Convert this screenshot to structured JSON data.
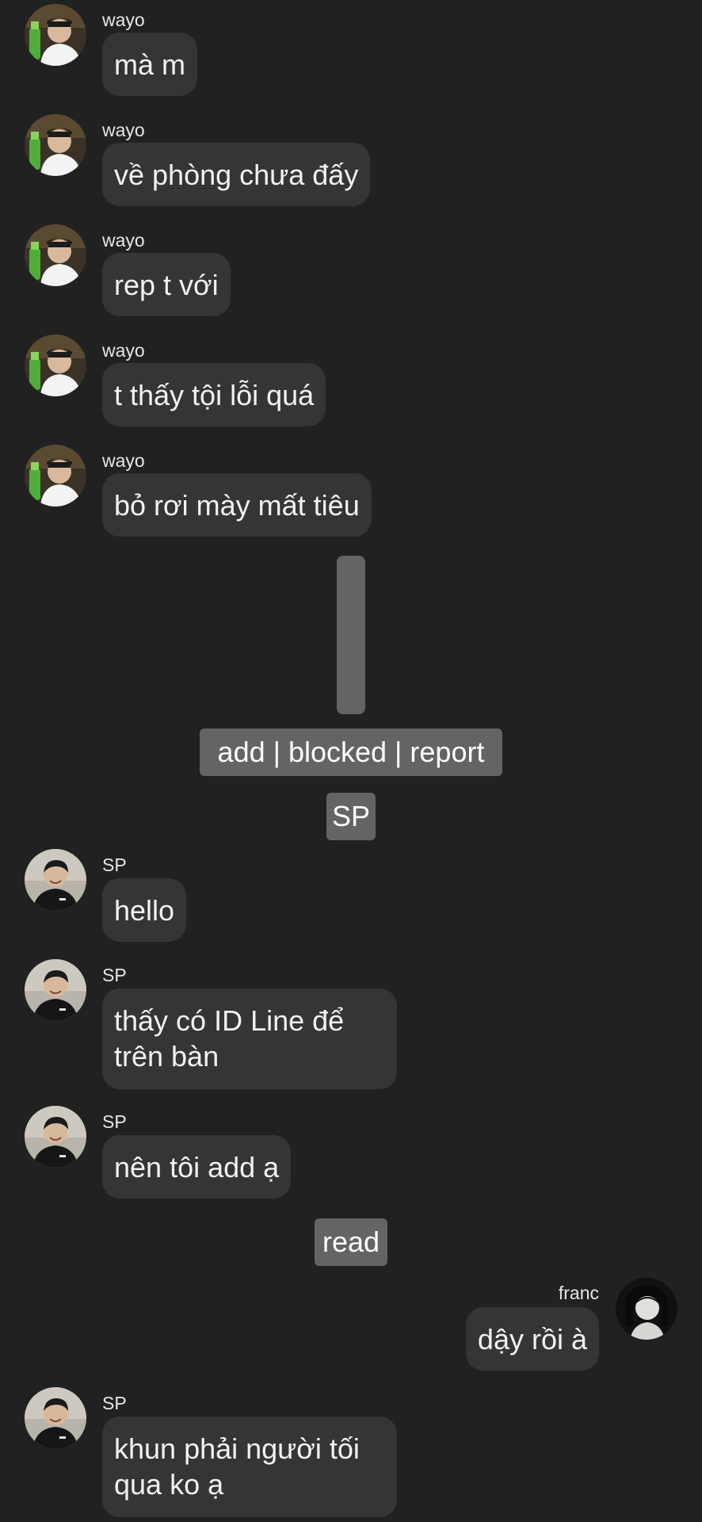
{
  "messages": [
    {
      "sender": "wayo",
      "text": "mà m"
    },
    {
      "sender": "wayo",
      "text": "về phòng chưa đấy"
    },
    {
      "sender": "wayo",
      "text": "rep t với"
    },
    {
      "sender": "wayo",
      "text": "t thấy tội lỗi quá"
    },
    {
      "sender": "wayo",
      "text": "bỏ rơi mày mất tiêu"
    },
    {
      "sender": "SP",
      "text": "hello"
    },
    {
      "sender": "SP",
      "text": "thấy có ID Line để trên bàn"
    },
    {
      "sender": "SP",
      "text": "nên tôi add ạ"
    },
    {
      "sender": "franc",
      "text": "dậy rồi à"
    },
    {
      "sender": "SP",
      "text": "khun phải người tối qua ko ạ"
    }
  ],
  "system": {
    "actions_label": "add | blocked | report",
    "contact_label": "SP",
    "read_label": "read"
  },
  "colors": {
    "background": "#212121",
    "bubble": "#353535",
    "system_chip": "#646464",
    "text": "#f2f2f2"
  },
  "icons": {
    "wayo_avatar": "avatar-wayo-icon",
    "sp_avatar": "avatar-sp-icon",
    "franc_avatar": "avatar-franc-icon"
  }
}
